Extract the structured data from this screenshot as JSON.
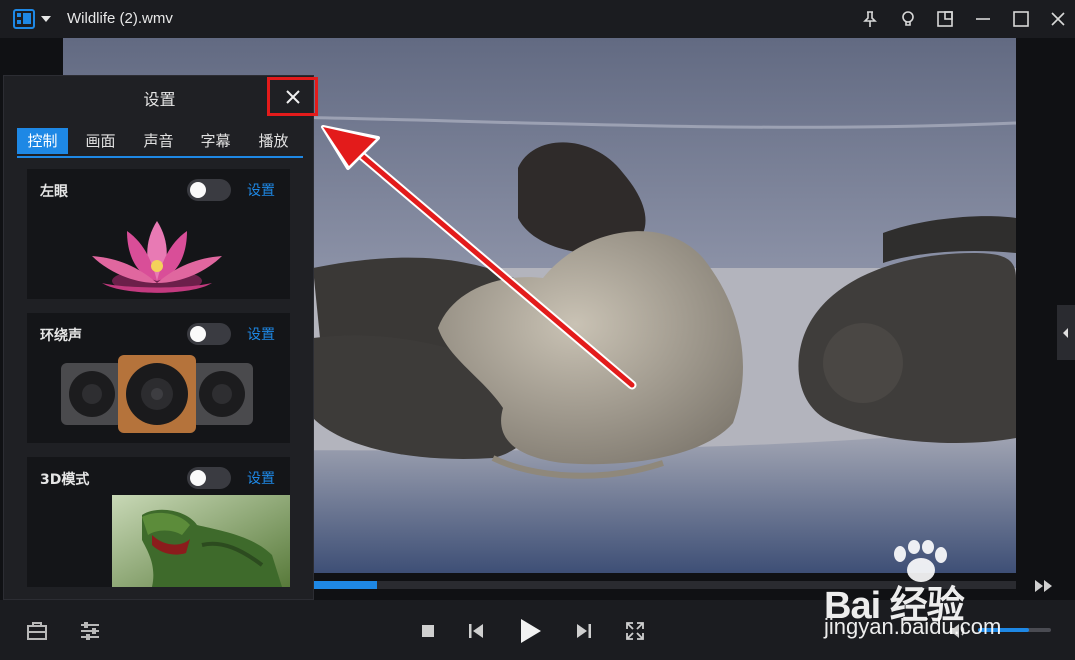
{
  "titlebar": {
    "title": "Wildlife (2).wmv",
    "buttons": [
      "pin-icon",
      "tips-icon",
      "mini-mode-icon",
      "minimize-icon",
      "maximize-icon",
      "close-icon"
    ]
  },
  "settings_panel": {
    "title": "设置",
    "tabs": [
      {
        "label": "控制",
        "active": true
      },
      {
        "label": "画面",
        "active": false
      },
      {
        "label": "声音",
        "active": false
      },
      {
        "label": "字幕",
        "active": false
      },
      {
        "label": "播放",
        "active": false
      }
    ],
    "cards": [
      {
        "label": "左眼",
        "toggle_on": false,
        "action": "设置",
        "image": "lotus-image"
      },
      {
        "label": "环绕声",
        "toggle_on": false,
        "action": "设置",
        "image": "speakers-image"
      },
      {
        "label": "3D模式",
        "toggle_on": false,
        "action": "设置",
        "image": "dinosaur-image"
      }
    ]
  },
  "player": {
    "progress_fraction": 0.33,
    "volume_fraction": 0.7
  },
  "watermark": {
    "brand": "Bai  经验",
    "sub": "jingyan.baidu.com"
  },
  "colors": {
    "accent": "#1e88e5",
    "highlight_box": "#e31b1b",
    "arrow": "#e31b1b",
    "panel_bg": "#1f2024",
    "titlebar_bg": "#1b1c20"
  }
}
